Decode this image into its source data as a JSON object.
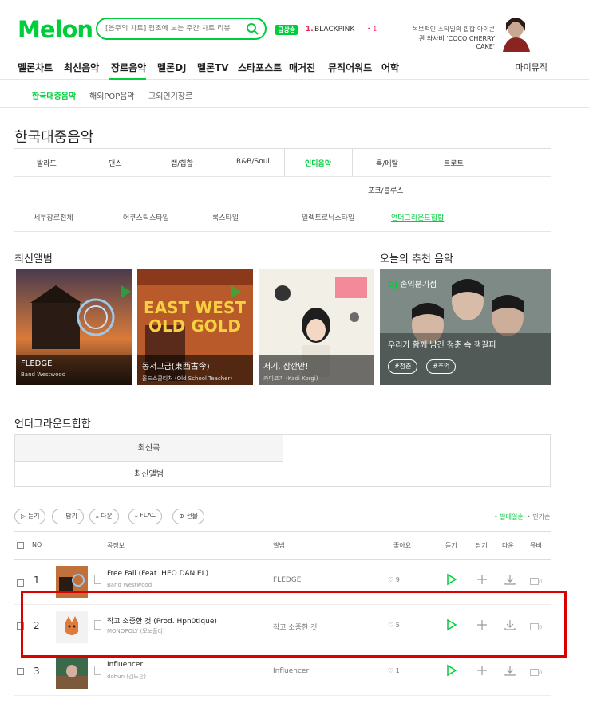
{
  "header": {
    "logo": "Melon",
    "search_placeholder": "[음주의 차트] 팝초에 보는 주간 차트 리뷰",
    "rising_badge": "급상승",
    "rising_rank": "1.",
    "rising_artist": "BLACKPINK",
    "rising_change": "• 1",
    "ad_line1": "독보적인 스타일의 힙합 아이콘",
    "ad_line2": "퀸 와사비 'COCO CHERRY CAKE'"
  },
  "gnb": {
    "items": [
      "멜론차트",
      "최신음악",
      "장르음악",
      "멜론DJ",
      "멜론TV",
      "스타포스트",
      "매거진",
      "뮤직어워드",
      "어학"
    ],
    "active": "장르음악",
    "mymusic": "마이뮤직"
  },
  "subnav": {
    "items": [
      "한국대중음악",
      "해외POP음악",
      "그외인기장르"
    ],
    "active": "한국대중음악"
  },
  "page_title": "한국대중음악",
  "genres": {
    "row1": [
      "발라드",
      "댄스",
      "랩/힙합",
      "R&B/Soul",
      "인디음악",
      "록/메탈",
      "트로트"
    ],
    "row2": [
      "포크/블루스"
    ],
    "active": "인디음악",
    "sub": [
      "세부장르전체",
      "어쿠스틱스타일",
      "록스타일",
      "일렉트로닉스타일",
      "언더그라운드힙합"
    ],
    "sub_active": "언더그라운드힙합"
  },
  "latest_albums": {
    "title": "최신앨범",
    "items": [
      {
        "title": "FLEDGE",
        "artist": "Band Westwood"
      },
      {
        "title": "동서고금(東西古今)",
        "artist": "올드스쿨티처 (Old School Teacher)"
      },
      {
        "title": "저기, 잠깐만!",
        "artist": "카디코기 (Kadi Korgi)"
      }
    ]
  },
  "recommend": {
    "title": "오늘의 추천 음악",
    "dj_label": "DJ",
    "dj_name": "손익분기점",
    "desc": "우리가 함께 남긴 청춘 속 책갈피",
    "tags": [
      "#청춘",
      "#추억"
    ]
  },
  "underground": {
    "title": "언더그라운드힙합",
    "tabs": [
      "최신곡",
      "최신앨범"
    ]
  },
  "toolbar": {
    "buttons": [
      "듣기",
      "담기",
      "다운",
      "FLAC",
      "선물"
    ],
    "sort_new": "• 발매일순",
    "sort_pop": "• 인기순"
  },
  "table": {
    "headers": {
      "no": "NO",
      "song": "곡정보",
      "album": "앨범",
      "like": "좋아요",
      "play": "듣기",
      "add": "담기",
      "down": "다운",
      "mv": "뮤비"
    },
    "rows": [
      {
        "no": "1",
        "title": "Free Fall (Feat. HEO DANIEL)",
        "artist": "Band Westwood",
        "album": "FLEDGE",
        "likes": "9",
        "mv": "0"
      },
      {
        "no": "2",
        "title": "작고 소중한 것 (Prod. Hpn0tique)",
        "artist": "MONOPOLY (모노폴리)",
        "album": "작고 소중한 것",
        "likes": "5",
        "mv": "0"
      },
      {
        "no": "3",
        "title": "Influencer",
        "artist": "dohun (김도훈)",
        "album": "Influencer",
        "likes": "1",
        "mv": "0"
      }
    ]
  },
  "colors": {
    "brand": "#00cd3c",
    "accent_red": "#e4285a",
    "highlight": "#d90000"
  }
}
